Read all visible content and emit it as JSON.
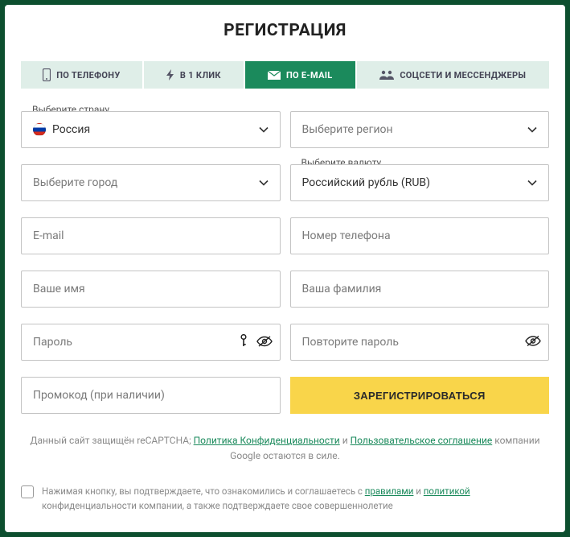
{
  "title": "РЕГИСТРАЦИЯ",
  "tabs": {
    "phone": "ПО ТЕЛЕФОНУ",
    "oneclick": "В 1 КЛИК",
    "email": "ПО E-MAIL",
    "social": "СОЦСЕТИ И МЕССЕНДЖЕРЫ"
  },
  "labels": {
    "country": "Выберите страну",
    "currency": "Выберите валюту"
  },
  "values": {
    "country": "Россия",
    "currency": "Российский рубль (RUB)"
  },
  "placeholders": {
    "region": "Выберите регион",
    "city": "Выберите город",
    "email": "E-mail",
    "phone": "Номер телефона",
    "firstname": "Ваше имя",
    "lastname": "Ваша фамилия",
    "password": "Пароль",
    "password2": "Повторите пароль",
    "promo": "Промокод (при наличии)"
  },
  "submit": "ЗАРЕГИСТРИРОВАТЬСЯ",
  "recaptcha": {
    "prefix": "Данный сайт защищён reCAPTCHA; ",
    "link1": "Политика Конфиденциальности",
    "mid": " и ",
    "link2": "Пользовательское соглашение",
    "suffix": " компании Google остаются в силе."
  },
  "consent": {
    "prefix": "Нажимая кнопку, вы подтверждаете, что ознакомились и соглашаетесь с ",
    "link1": "правилами",
    "mid": " и ",
    "link2": "политикой",
    "suffix": " конфиденциальности компании, а также подтверждаете свое совершеннолетие"
  }
}
